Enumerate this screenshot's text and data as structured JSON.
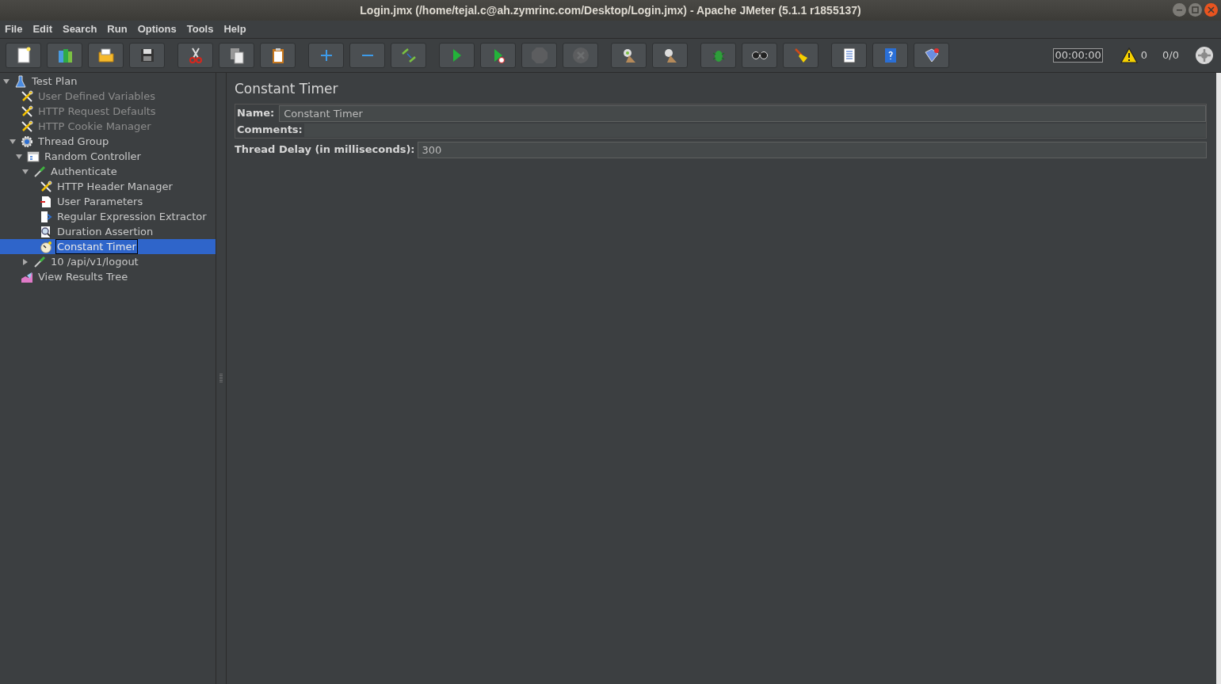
{
  "window": {
    "title": "Login.jmx (/home/tejal.c@ah.zymrinc.com/Desktop/Login.jmx) - Apache JMeter (5.1.1 r1855137)"
  },
  "menu": [
    "File",
    "Edit",
    "Search",
    "Run",
    "Options",
    "Tools",
    "Help"
  ],
  "toolbar": [
    [
      {
        "kind": "new",
        "disabled": false
      },
      {
        "kind": "templates",
        "disabled": false
      },
      {
        "kind": "open",
        "disabled": false
      },
      {
        "kind": "save",
        "disabled": false
      }
    ],
    [
      {
        "kind": "cut",
        "disabled": false
      },
      {
        "kind": "copy",
        "disabled": false
      },
      {
        "kind": "paste",
        "disabled": false
      }
    ],
    [
      {
        "kind": "expand",
        "disabled": false
      },
      {
        "kind": "collapse",
        "disabled": false
      },
      {
        "kind": "toggle",
        "disabled": false
      }
    ],
    [
      {
        "kind": "start",
        "disabled": false
      },
      {
        "kind": "start-no-pause",
        "disabled": false
      },
      {
        "kind": "stop",
        "disabled": true
      },
      {
        "kind": "shutdown",
        "disabled": true
      }
    ],
    [
      {
        "kind": "remote-start",
        "disabled": false
      },
      {
        "kind": "remote-stop",
        "disabled": false
      }
    ],
    [
      {
        "kind": "debug",
        "disabled": false
      },
      {
        "kind": "search",
        "disabled": false
      },
      {
        "kind": "clear",
        "disabled": false
      }
    ],
    [
      {
        "kind": "log",
        "disabled": false
      },
      {
        "kind": "help",
        "disabled": false
      },
      {
        "kind": "plugins",
        "disabled": false
      }
    ]
  ],
  "status": {
    "elapsed": "00:00:00",
    "warnings": "0",
    "threads": "0/0"
  },
  "tree": [
    {
      "label": "Test Plan",
      "kind": "plan",
      "disabled": false,
      "selected": false,
      "expanded": true,
      "children": [
        {
          "label": "User Defined Variables",
          "kind": "config",
          "disabled": true,
          "selected": false
        },
        {
          "label": "HTTP Request Defaults",
          "kind": "config",
          "disabled": true,
          "selected": false
        },
        {
          "label": "HTTP Cookie Manager",
          "kind": "config",
          "disabled": true,
          "selected": false
        },
        {
          "label": "Thread Group",
          "kind": "threads",
          "disabled": false,
          "selected": false,
          "expanded": true,
          "children": [
            {
              "label": "Random Controller",
              "kind": "controller",
              "disabled": false,
              "selected": false,
              "expanded": true,
              "children": [
                {
                  "label": "Authenticate",
                  "kind": "sampler",
                  "disabled": false,
                  "selected": false,
                  "expanded": true,
                  "children": [
                    {
                      "label": "HTTP Header Manager",
                      "kind": "config",
                      "disabled": false,
                      "selected": false
                    },
                    {
                      "label": "User Parameters",
                      "kind": "preprocessor",
                      "disabled": false,
                      "selected": false
                    },
                    {
                      "label": "Regular Expression Extractor",
                      "kind": "postprocessor",
                      "disabled": false,
                      "selected": false
                    },
                    {
                      "label": "Duration Assertion",
                      "kind": "assertion",
                      "disabled": false,
                      "selected": false
                    },
                    {
                      "label": "Constant Timer",
                      "kind": "timer",
                      "disabled": false,
                      "selected": true
                    }
                  ]
                },
                {
                  "label": "10 /api/v1/logout",
                  "kind": "sampler",
                  "disabled": false,
                  "selected": false,
                  "expanded": false
                }
              ]
            }
          ]
        },
        {
          "label": "View Results Tree",
          "kind": "listener",
          "disabled": false,
          "selected": false
        }
      ]
    }
  ],
  "panel": {
    "title": "Constant Timer",
    "name_label": "Name:",
    "name_value": "Constant Timer",
    "comments_label": "Comments:",
    "delay_label": "Thread Delay (in milliseconds):",
    "delay_value": "300"
  }
}
